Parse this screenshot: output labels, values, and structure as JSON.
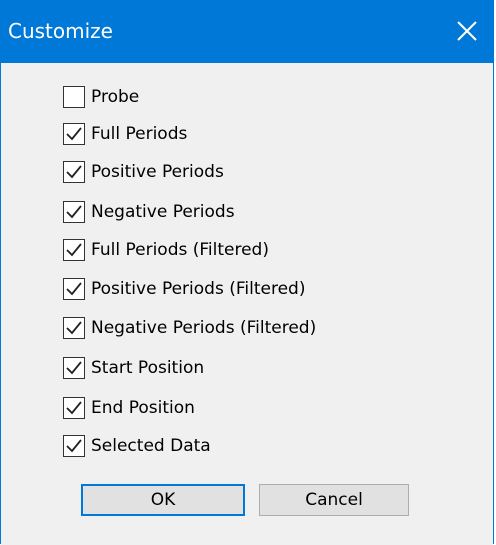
{
  "window": {
    "title": "Customize",
    "close_icon": "close-icon"
  },
  "options": [
    {
      "label": "Probe",
      "checked": false
    },
    {
      "label": "Full Periods",
      "checked": true
    },
    {
      "label": "Positive Periods",
      "checked": true
    },
    {
      "label": "Negative Periods",
      "checked": true
    },
    {
      "label": "Full Periods (Filtered)",
      "checked": true
    },
    {
      "label": "Positive Periods (Filtered)",
      "checked": true
    },
    {
      "label": "Negative Periods (Filtered)",
      "checked": true
    },
    {
      "label": "Start Position",
      "checked": true
    },
    {
      "label": "End Position",
      "checked": true
    },
    {
      "label": "Selected Data",
      "checked": true
    }
  ],
  "buttons": {
    "ok_label": "OK",
    "cancel_label": "Cancel"
  },
  "colors": {
    "titlebar": "#0078d7",
    "client": "#f0f0f0",
    "button": "#e1e1e1"
  }
}
